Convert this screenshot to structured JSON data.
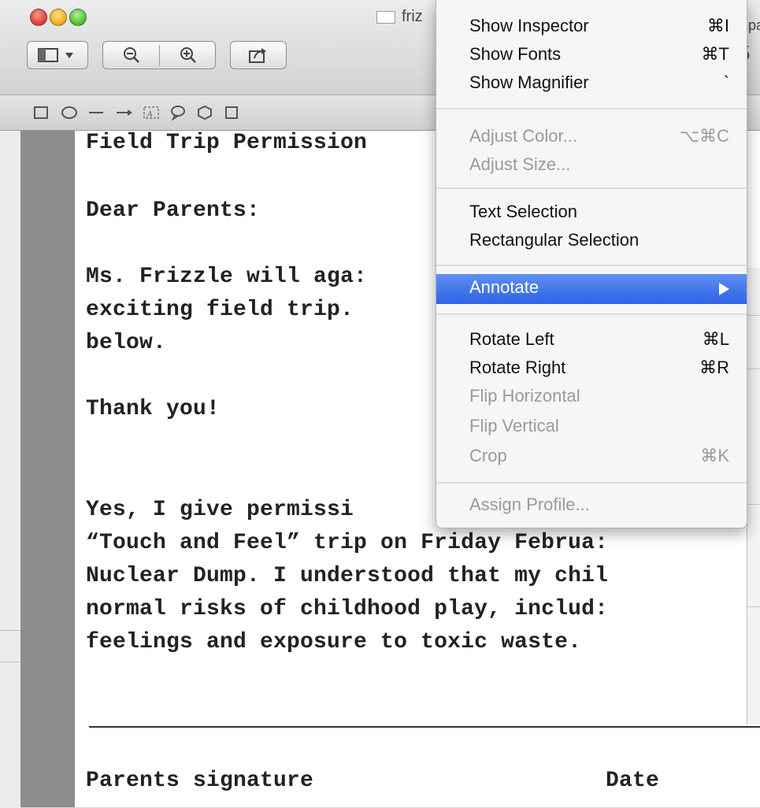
{
  "window": {
    "title": "friz",
    "title_tail": "pa",
    "title_tail2": "5"
  },
  "document": {
    "lines": [
      "Field Trip Permission",
      "Dear Parents:",
      "Ms. Frizzle will aga:",
      "exciting field trip.",
      "below.",
      "Thank you!",
      "Yes, I give permissi",
      "“Touch and Feel” trip on Friday Februa:",
      "Nuclear Dump. I understood that my chil",
      "normal risks of childhood play, includ:",
      "feelings and exposure to toxic waste."
    ],
    "signature_label": "Parents signature",
    "date_label": "Date"
  },
  "menu": {
    "show_inspector": {
      "label": "Show Inspector",
      "shortcut": "⌘I"
    },
    "show_fonts": {
      "label": "Show Fonts",
      "shortcut": "⌘T"
    },
    "show_magnifier": {
      "label": "Show Magnifier",
      "shortcut": "`"
    },
    "adjust_color": {
      "label": "Adjust Color...",
      "shortcut": "⌥⌘C"
    },
    "adjust_size": {
      "label": "Adjust Size..."
    },
    "text_selection": {
      "label": "Text Selection"
    },
    "rectangular_selection": {
      "label": "Rectangular Selection"
    },
    "annotate": {
      "label": "Annotate"
    },
    "rotate_left": {
      "label": "Rotate Left",
      "shortcut": "⌘L"
    },
    "rotate_right": {
      "label": "Rotate Right",
      "shortcut": "⌘R"
    },
    "flip_horizontal": {
      "label": "Flip Horizontal"
    },
    "flip_vertical": {
      "label": "Flip Vertical"
    },
    "crop": {
      "label": "Crop",
      "shortcut": "⌘K"
    },
    "assign_profile": {
      "label": "Assign Profile..."
    }
  },
  "colors": {
    "highlight": "#2e63e6",
    "disabled_text": "#9a9a9a"
  }
}
